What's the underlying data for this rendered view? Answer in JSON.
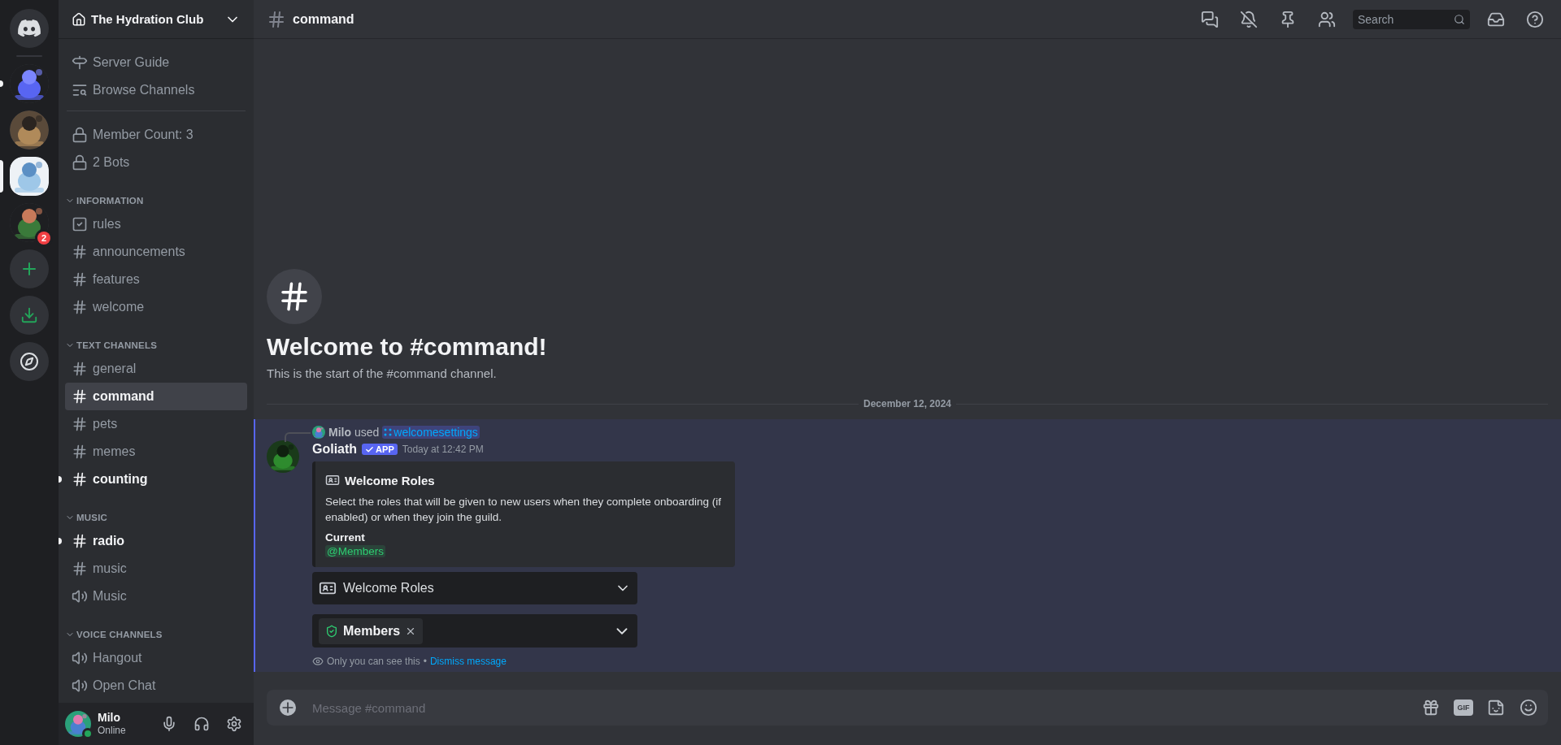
{
  "servers": [
    {
      "kind": "home",
      "selected": false,
      "unread": false
    },
    {
      "kind": "picture",
      "selected": false,
      "unread": true
    },
    {
      "kind": "picture",
      "selected": false,
      "unread": false
    },
    {
      "kind": "picture",
      "selected": true,
      "unread": false
    },
    {
      "kind": "picture",
      "selected": false,
      "unread": false,
      "badge": "2"
    },
    {
      "kind": "add",
      "selected": false,
      "unread": false
    },
    {
      "kind": "download",
      "selected": false,
      "unread": false
    },
    {
      "kind": "discover",
      "selected": false,
      "unread": false
    }
  ],
  "server_header": {
    "name": "The Hydration Club"
  },
  "shortcuts": [
    {
      "kind": "guide",
      "label": "Server Guide"
    },
    {
      "kind": "browse",
      "label": "Browse Channels"
    }
  ],
  "pinned_channels": [
    {
      "name": "Member Count: 3",
      "kind": "locked",
      "selected": false,
      "unread": false
    },
    {
      "name": "2 Bots",
      "kind": "locked",
      "selected": false,
      "unread": false
    }
  ],
  "categories": [
    {
      "name": "INFORMATION",
      "expanded": true,
      "channels": [
        {
          "name": "rules",
          "kind": "rules",
          "selected": false,
          "unread": false
        },
        {
          "name": "announcements",
          "kind": "text",
          "selected": false,
          "unread": false
        },
        {
          "name": "features",
          "kind": "text",
          "selected": false,
          "unread": false
        },
        {
          "name": "welcome",
          "kind": "text",
          "selected": false,
          "unread": false
        }
      ]
    },
    {
      "name": "TEXT CHANNELS",
      "expanded": true,
      "channels": [
        {
          "name": "general",
          "kind": "text",
          "selected": false,
          "unread": false
        },
        {
          "name": "command",
          "kind": "text",
          "selected": true,
          "unread": false
        },
        {
          "name": "pets",
          "kind": "text",
          "selected": false,
          "unread": false
        },
        {
          "name": "memes",
          "kind": "text",
          "selected": false,
          "unread": false
        },
        {
          "name": "counting",
          "kind": "text",
          "selected": false,
          "unread": true
        }
      ]
    },
    {
      "name": "MUSIC",
      "expanded": true,
      "channels": [
        {
          "name": "radio",
          "kind": "text",
          "selected": false,
          "unread": true
        },
        {
          "name": "music",
          "kind": "text",
          "selected": false,
          "unread": false
        },
        {
          "name": "Music",
          "kind": "voice",
          "selected": false,
          "unread": false
        }
      ]
    },
    {
      "name": "VOICE CHANNELS",
      "expanded": true,
      "channels": [
        {
          "name": "Hangout",
          "kind": "voice",
          "selected": false,
          "unread": false
        },
        {
          "name": "Open Chat",
          "kind": "voice",
          "selected": false,
          "unread": false
        }
      ]
    }
  ],
  "user_panel": {
    "name": "Milo",
    "status": "Online"
  },
  "header": {
    "channel": "command",
    "search": {
      "placeholder": "Search"
    }
  },
  "welcome": {
    "title": "Welcome to #command!",
    "subtitle": "This is the start of the #command channel."
  },
  "date_divider": "December 12, 2024",
  "message": {
    "reply": {
      "user": "Milo",
      "verb": "used",
      "command": "welcomesettings"
    },
    "author": "Goliath",
    "badge": "APP",
    "timestamp": "Today at 12:42 PM",
    "embed": {
      "title": "Welcome Roles",
      "description": "Select the roles that will be given to new users when they complete onboarding (if enabled) or when they join the guild.",
      "field_name": "Current",
      "field_value": "@Members"
    },
    "selects": [
      {
        "kind": "placeholder",
        "label": "Welcome Roles"
      },
      {
        "kind": "chips",
        "chips": [
          {
            "label": "Members"
          }
        ]
      }
    ],
    "notice": {
      "text": "Only you can see this",
      "separator": "•",
      "link": "Dismiss message"
    }
  },
  "composer": {
    "placeholder": "Message #command",
    "gif_label": "GIF"
  }
}
